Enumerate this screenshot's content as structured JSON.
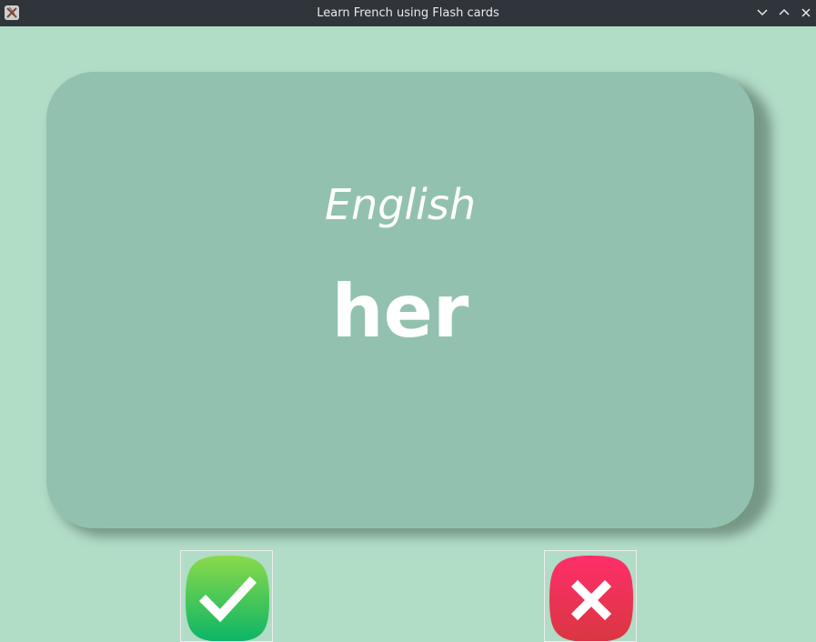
{
  "window": {
    "title": "Learn French using Flash cards",
    "app_icon": "tk-feather-icon",
    "controls": [
      "minimize-icon",
      "maximize-icon",
      "close-icon"
    ]
  },
  "card": {
    "language": "English",
    "word": "her",
    "color": "#92c2af"
  },
  "buttons": {
    "right": {
      "icon": "checkmark-icon",
      "color_top": "#8bd94a",
      "color_bottom": "#0ab567"
    },
    "wrong": {
      "icon": "cross-icon",
      "color_top": "#ff2e6b",
      "color_bottom": "#d93740"
    }
  },
  "colors": {
    "background": "#b1dcc6",
    "titlebar": "#30343b"
  }
}
